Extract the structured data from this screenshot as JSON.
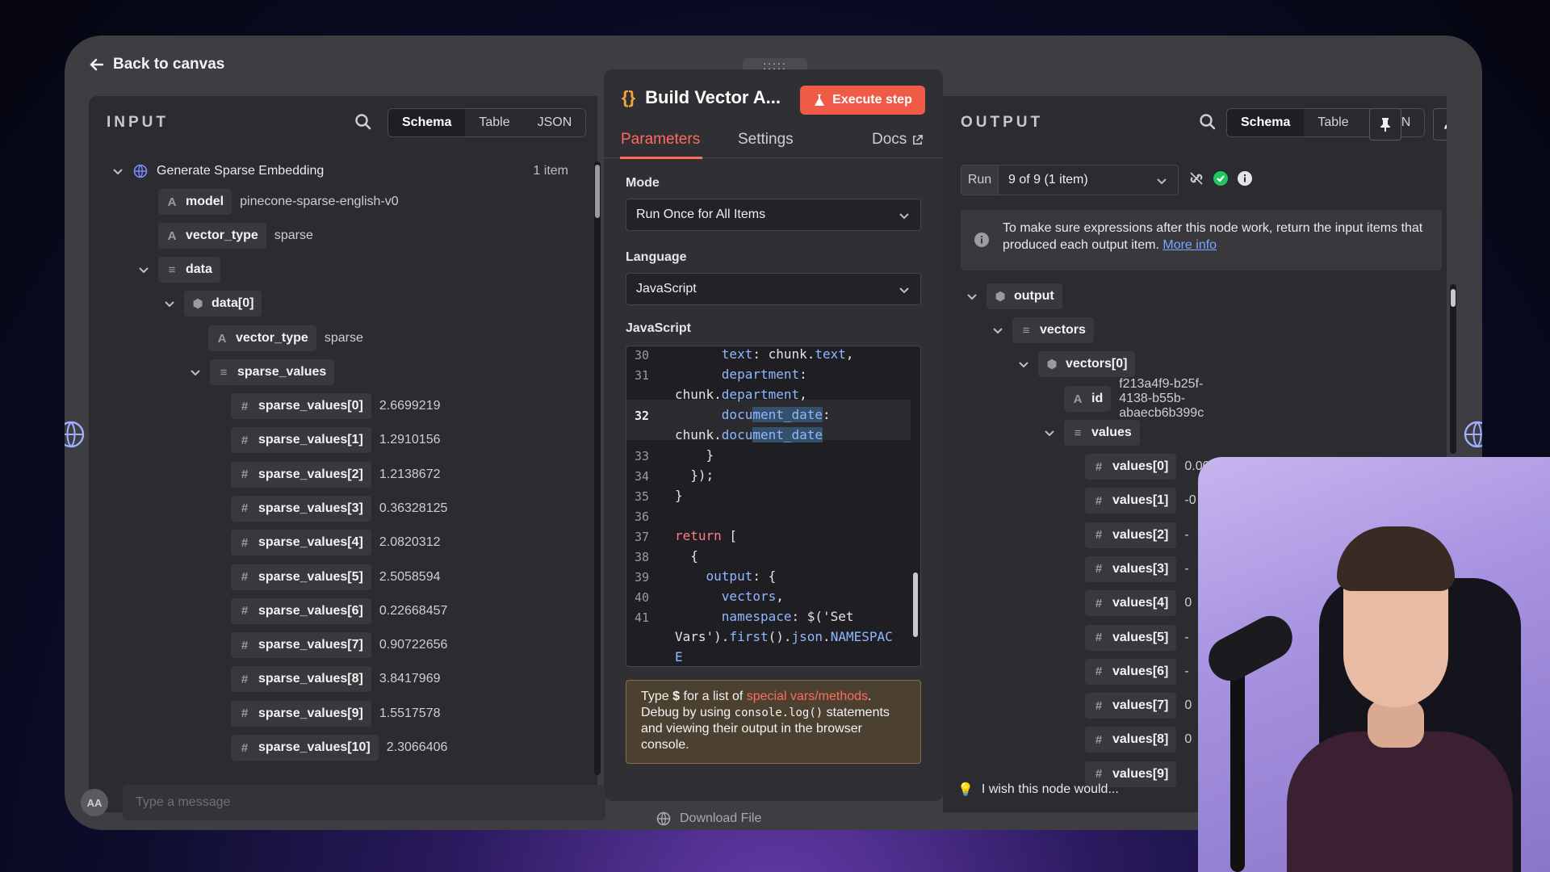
{
  "back_label": "Back to canvas",
  "input": {
    "title": "INPUT",
    "views": [
      "Schema",
      "Table",
      "JSON"
    ],
    "root_label": "Generate Sparse Embedding",
    "item_count": "1 item",
    "model_key": "model",
    "model_val": "pinecone-sparse-english-v0",
    "vector_type_key": "vector_type",
    "vector_type_val": "sparse",
    "data_key": "data",
    "data0_key": "data[0]",
    "inner_vector_type_key": "vector_type",
    "inner_vector_type_val": "sparse",
    "sparse_values_key": "sparse_values",
    "sparse_values": [
      {
        "k": "sparse_values[0]",
        "v": "2.6699219"
      },
      {
        "k": "sparse_values[1]",
        "v": "1.2910156"
      },
      {
        "k": "sparse_values[2]",
        "v": "1.2138672"
      },
      {
        "k": "sparse_values[3]",
        "v": "0.36328125"
      },
      {
        "k": "sparse_values[4]",
        "v": "2.0820312"
      },
      {
        "k": "sparse_values[5]",
        "v": "2.5058594"
      },
      {
        "k": "sparse_values[6]",
        "v": "0.22668457"
      },
      {
        "k": "sparse_values[7]",
        "v": "0.90722656"
      },
      {
        "k": "sparse_values[8]",
        "v": "3.8417969"
      },
      {
        "k": "sparse_values[9]",
        "v": "1.5517578"
      },
      {
        "k": "sparse_values[10]",
        "v": "2.3066406"
      }
    ],
    "type_glyph_string": "A",
    "type_glyph_number": "#"
  },
  "node": {
    "handle": ":::::",
    "title": "Build Vector A...",
    "execute_label": "Execute step",
    "tabs": [
      "Parameters",
      "Settings",
      "Docs"
    ],
    "mode_label": "Mode",
    "mode_value": "Run Once for All Items",
    "language_label": "Language",
    "language_value": "JavaScript",
    "code_label": "JavaScript",
    "line_numbers": [
      "30",
      "31",
      "",
      "32",
      "",
      "33",
      "34",
      "35",
      "36",
      "37",
      "38",
      "39",
      "40",
      "41",
      "",
      ""
    ],
    "hint_prefix": "Type ",
    "hint_dollar": "$",
    "hint_mid": " for a list of ",
    "hint_link": "special vars/methods",
    "hint_dot": ".",
    "hint_line2_a": "Debug by using ",
    "hint_code": "console.log()",
    "hint_line2_b": " statements",
    "hint_line3": "and viewing their output in the browser",
    "hint_line4": "console."
  },
  "output": {
    "title": "OUTPUT",
    "views": [
      "Schema",
      "Table",
      "JSON"
    ],
    "run_label": "Run",
    "run_value": "9 of 9 (1 item)",
    "notice_text": "To make sure expressions after this node work, return the input items that produced each output item.",
    "notice_link": "More info",
    "output_key": "output",
    "vectors_key": "vectors",
    "vectors0_key": "vectors[0]",
    "id_key": "id",
    "id_val": "f213a4f9-b25f-4138-b55b-abaecb6b399c",
    "values_key": "values",
    "values": [
      {
        "k": "values[0]",
        "v": "0.00"
      },
      {
        "k": "values[1]",
        "v": "-0"
      },
      {
        "k": "values[2]",
        "v": "-"
      },
      {
        "k": "values[3]",
        "v": "-"
      },
      {
        "k": "values[4]",
        "v": "0"
      },
      {
        "k": "values[5]",
        "v": "-"
      },
      {
        "k": "values[6]",
        "v": "-"
      },
      {
        "k": "values[7]",
        "v": "0"
      },
      {
        "k": "values[8]",
        "v": "0"
      },
      {
        "k": "values[9]",
        "v": ""
      }
    ]
  },
  "footer": {
    "chat_avatar": "AA",
    "chat_placeholder": "Type a message",
    "download_label": "Download File",
    "feedback_label": "I wish this node would..."
  },
  "colors": {
    "accent": "#ff6d5a",
    "execute": "#ef5b47",
    "success": "#22c55e",
    "link": "#7aa7ff"
  }
}
